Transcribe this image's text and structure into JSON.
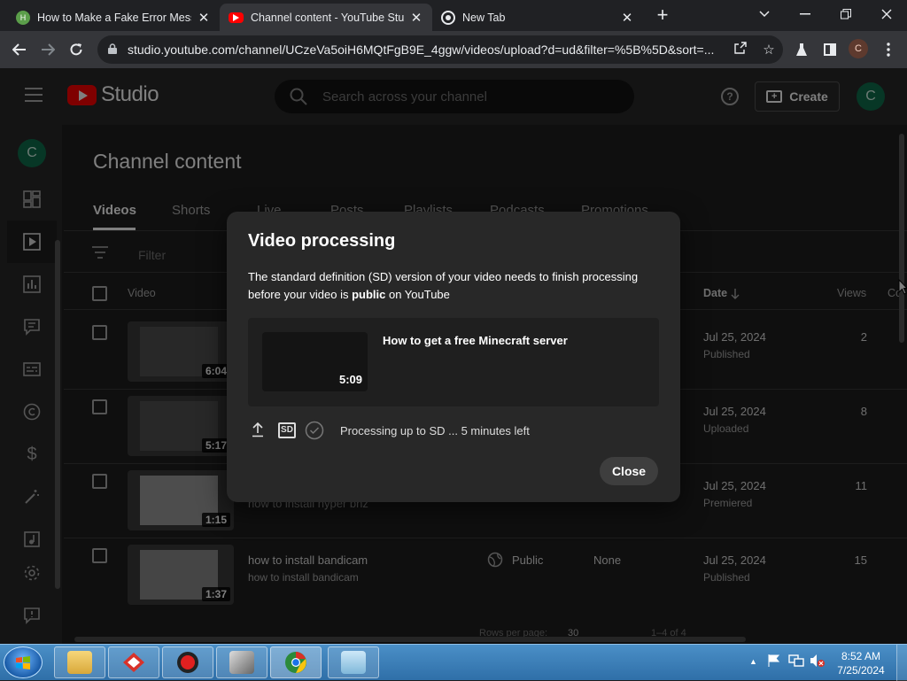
{
  "browser": {
    "tabs": [
      {
        "title": "How to Make a Fake Error Messa",
        "active": false
      },
      {
        "title": "Channel content - YouTube Studi",
        "active": true
      },
      {
        "title": "New Tab",
        "active": false
      }
    ],
    "url": "studio.youtube.com/channel/UCzeVa5oiH6MQtFgB9E_4ggw/videos/upload?d=ud&filter=%5B%5D&sort=...",
    "profile_initial": "C"
  },
  "studio": {
    "brand": "Studio",
    "search_placeholder": "Search across your channel",
    "create_label": "Create",
    "avatar_initial": "C",
    "page_title": "Channel content",
    "tabs": [
      "Videos",
      "Shorts",
      "Live",
      "Posts",
      "Playlists",
      "Podcasts",
      "Promotions"
    ],
    "filter_placeholder": "Filter",
    "columns": {
      "video": "Video",
      "date": "Date",
      "views": "Views",
      "comments": "Co"
    },
    "rows": [
      {
        "duration": "6:04",
        "title": "",
        "subtitle": "",
        "visibility": "",
        "restrictions": "",
        "date": "Jul 25, 2024",
        "status": "Published",
        "views": "2"
      },
      {
        "duration": "5:17",
        "title": "",
        "subtitle": "",
        "visibility": "",
        "restrictions": "",
        "date": "Jul 25, 2024",
        "status": "Uploaded",
        "views": "8"
      },
      {
        "duration": "1:15",
        "title": "",
        "subtitle": "how to install hyper bnz",
        "visibility": "",
        "restrictions": "",
        "date": "Jul 25, 2024",
        "status": "Premiered",
        "views": "11"
      },
      {
        "duration": "1:37",
        "title": "how to install bandicam",
        "subtitle": "how to install bandicam",
        "visibility": "Public",
        "restrictions": "None",
        "date": "Jul 25, 2024",
        "status": "Published",
        "views": "15"
      }
    ],
    "pager": {
      "rows_label": "Rows per page:",
      "rows_value": "30",
      "range": "1–4 of 4"
    }
  },
  "dialog": {
    "title": "Video processing",
    "message_before": "The standard definition (SD) version of your video needs to finish processing before your video is ",
    "message_bold": "public",
    "message_after": " on YouTube",
    "video_title": "How to get a free Minecraft server",
    "video_duration": "5:09",
    "sd_badge": "SD",
    "progress_text": "Processing up to SD ... 5 minutes left",
    "close_label": "Close"
  },
  "taskbar": {
    "time": "8:52 AM",
    "date": "7/25/2024"
  },
  "colors": {
    "youtube_red": "#ff0000",
    "avatar_green": "#0f6e4c",
    "taskbar_blue": "#2f6fa8"
  }
}
